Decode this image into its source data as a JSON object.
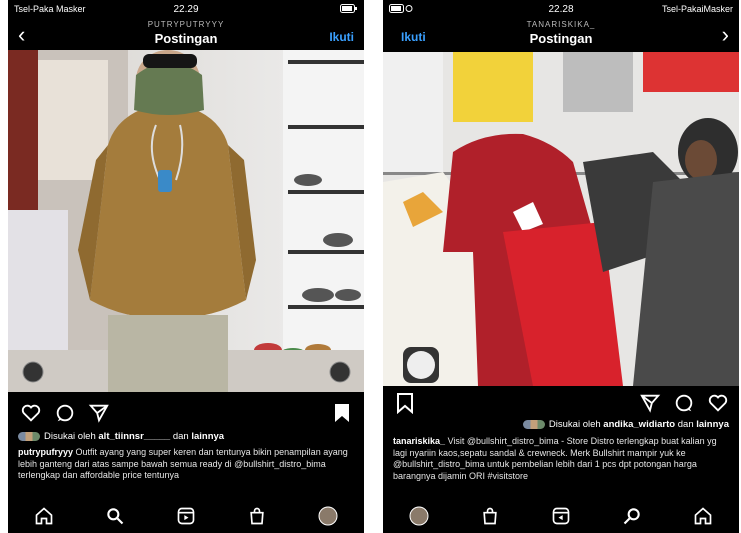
{
  "left": {
    "status": {
      "carrier": "Tsel-Paka Masker",
      "time": "22.29"
    },
    "header": {
      "username": "PUTRYPUTRYYY",
      "title": "Postingan",
      "follow": "Ikuti"
    },
    "likes": {
      "prefix": "Disukai oleh",
      "user": "alt_tiinnsr_____",
      "mid": "dan",
      "suffix": "lainnya"
    },
    "caption": {
      "author": "putrypufryyy",
      "text": "Outfit ayang yang super keren dan tentunya bikin penampilan ayang lebih ganteng dari atas sampe bawah semua ready di @bullshirt_distro_bima terlengkap dan affordable price tentunya"
    },
    "nav_items": [
      "home-icon",
      "search-icon",
      "reels-icon",
      "shop-icon",
      "profile-avatar"
    ]
  },
  "right": {
    "status": {
      "carrier": "Tsel-PakaiMasker",
      "time": "22.28"
    },
    "header": {
      "username": "TANARISKIKA_",
      "title": "Postingan",
      "follow": "Ikuti"
    },
    "likes": {
      "prefix": "Disukai oleh",
      "user": "andika_widiarto",
      "mid": "dan",
      "suffix": "lainnya"
    },
    "caption": {
      "author": "tanariskika_",
      "text": "Visit @bullshirt_distro_bima - Store Distro terlengkap buat kalian yg lagi nyariin kaos,sepatu sandal & crewneck. Merk Bullshirt mampir yuk ke @bullshirt_distro_bima untuk pembelian lebih dari 1 pcs dpt potongan harga barangnya dijamin ORI #visitstore"
    },
    "nav_items": [
      "profile-avatar",
      "shop-icon",
      "reels-icon",
      "search-icon",
      "home-icon"
    ]
  },
  "colors": {
    "background": "#000000",
    "link": "#3aa0ff",
    "sweater": "#a07a3a",
    "tshirt": "#b0202a"
  }
}
